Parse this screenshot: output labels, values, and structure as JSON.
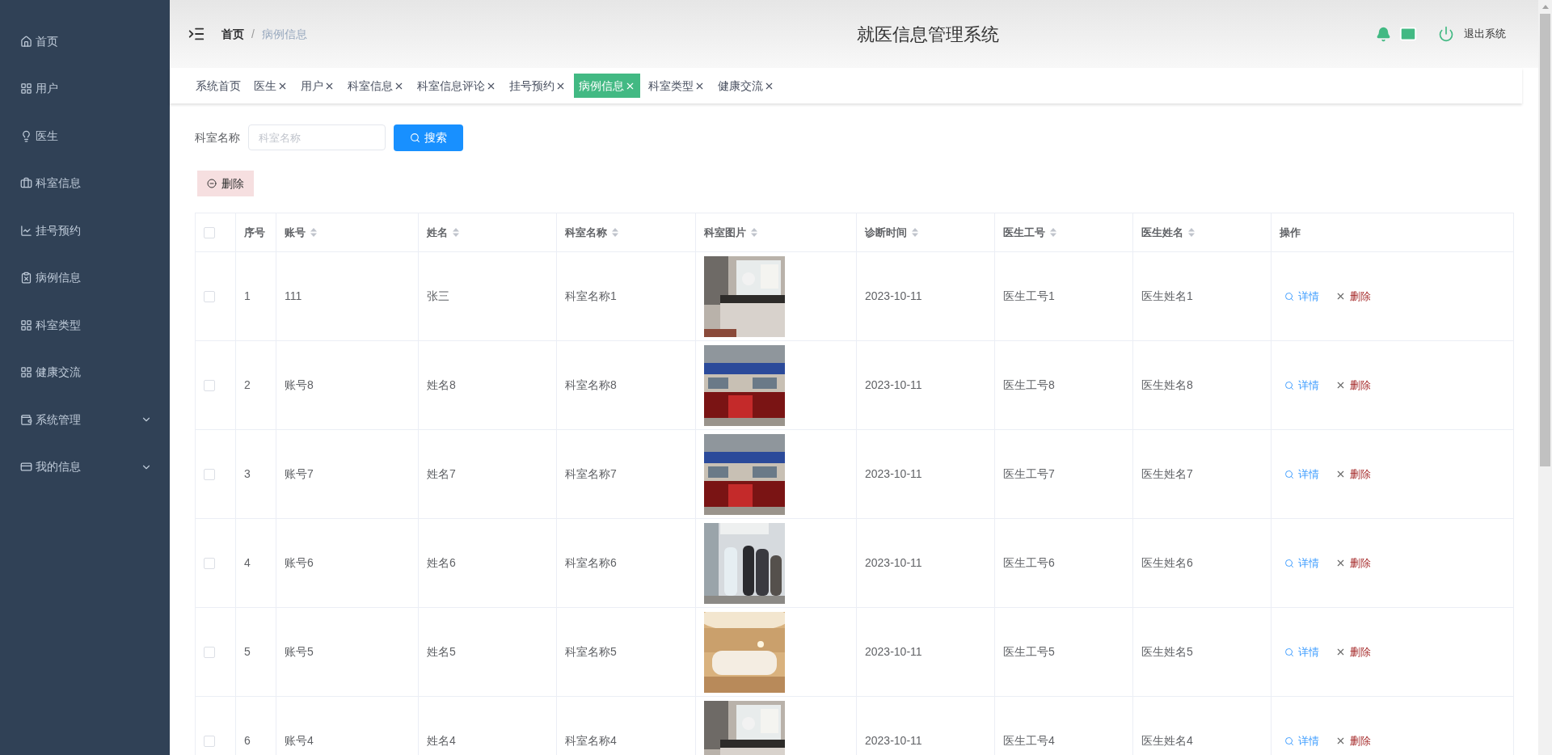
{
  "sidebar": {
    "items": [
      {
        "label": "首页",
        "kind": "link"
      },
      {
        "label": "用户",
        "kind": "link"
      },
      {
        "label": "医生",
        "kind": "link"
      },
      {
        "label": "科室信息",
        "kind": "link"
      },
      {
        "label": "挂号预约",
        "kind": "link"
      },
      {
        "label": "病例信息",
        "kind": "link"
      },
      {
        "label": "科室类型",
        "kind": "link"
      },
      {
        "label": "健康交流",
        "kind": "link"
      },
      {
        "label": "系统管理",
        "kind": "submenu"
      },
      {
        "label": "我的信息",
        "kind": "submenu"
      }
    ]
  },
  "header": {
    "breadcrumbs": [
      "首页",
      "病例信息"
    ],
    "separator": "/",
    "title": "就医信息管理系统",
    "logout": "退出系统"
  },
  "tabs": [
    {
      "label": "系统首页",
      "selected": false,
      "closable": false
    },
    {
      "label": "医生",
      "selected": false,
      "closable": true
    },
    {
      "label": "用户",
      "selected": false,
      "closable": true
    },
    {
      "label": "科室信息",
      "selected": false,
      "closable": true
    },
    {
      "label": "科室信息评论",
      "selected": false,
      "closable": true
    },
    {
      "label": "挂号预约",
      "selected": false,
      "closable": true
    },
    {
      "label": "病例信息",
      "selected": true,
      "closable": true
    },
    {
      "label": "科室类型",
      "selected": false,
      "closable": true
    },
    {
      "label": "健康交流",
      "selected": false,
      "closable": true
    }
  ],
  "search": {
    "label": "科室名称",
    "placeholder": "科室名称",
    "button": "搜索"
  },
  "delete_button": "删除",
  "table": {
    "all_checked": false,
    "columns": [
      {
        "label": "序号",
        "sortable": false
      },
      {
        "label": "账号",
        "sortable": true
      },
      {
        "label": "姓名",
        "sortable": true
      },
      {
        "label": "科室名称",
        "sortable": true
      },
      {
        "label": "科室图片",
        "sortable": true
      },
      {
        "label": "诊断时间",
        "sortable": true
      },
      {
        "label": "医生工号",
        "sortable": true
      },
      {
        "label": "医生姓名",
        "sortable": true
      },
      {
        "label": "操作",
        "sortable": false
      }
    ],
    "rows": [
      {
        "checked": false,
        "cells": [
          "1",
          "111",
          "张三",
          "科室名称1",
          "",
          "2023-10-11",
          "医生工号1",
          "医生姓名1"
        ],
        "actions": [
          "详情",
          "删除"
        ]
      },
      {
        "checked": false,
        "cells": [
          "2",
          "账号8",
          "姓名8",
          "科室名称8",
          "",
          "2023-10-11",
          "医生工号8",
          "医生姓名8"
        ],
        "actions": [
          "详情",
          "删除"
        ]
      },
      {
        "checked": false,
        "cells": [
          "3",
          "账号7",
          "姓名7",
          "科室名称7",
          "",
          "2023-10-11",
          "医生工号7",
          "医生姓名7"
        ],
        "actions": [
          "详情",
          "删除"
        ]
      },
      {
        "checked": false,
        "cells": [
          "4",
          "账号6",
          "姓名6",
          "科室名称6",
          "",
          "2023-10-11",
          "医生工号6",
          "医生姓名6"
        ],
        "actions": [
          "详情",
          "删除"
        ]
      },
      {
        "checked": false,
        "cells": [
          "5",
          "账号5",
          "姓名5",
          "科室名称5",
          "",
          "2023-10-11",
          "医生工号5",
          "医生姓名5"
        ],
        "actions": [
          "详情",
          "删除"
        ]
      },
      {
        "checked": false,
        "cells": [
          "6",
          "账号4",
          "姓名4",
          "科室名称4",
          "",
          "2023-10-11",
          "医生工号4",
          "医生姓名4"
        ],
        "actions": [
          "详情",
          "删除"
        ]
      }
    ]
  }
}
